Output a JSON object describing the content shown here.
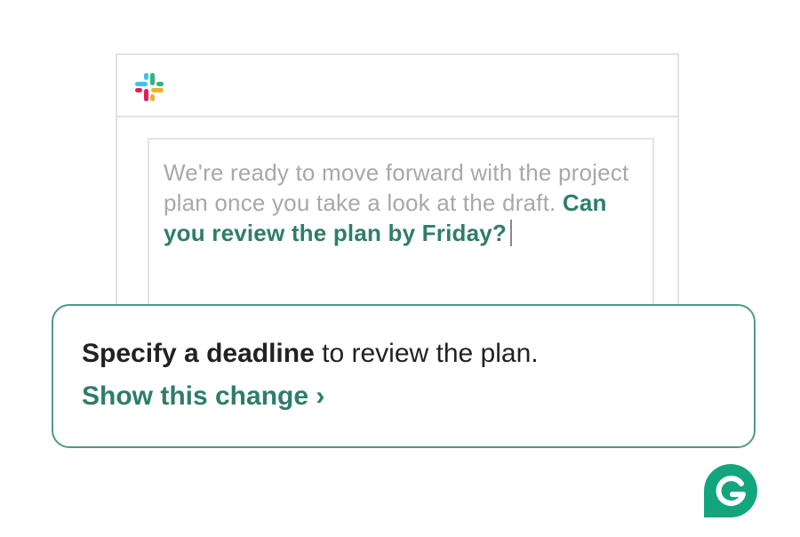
{
  "compose": {
    "text_plain": "We're ready to move forward with the project plan once you take a look at the draft.",
    "text_highlight": "Can you review the plan by Friday?"
  },
  "suggestion": {
    "bold": "Specify a deadline",
    "rest": "to review the plan.",
    "action_label": "Show this change ›"
  },
  "colors": {
    "accent": "#2e7d6b",
    "card_border": "#4f9a88",
    "placeholder_text": "#a8a8a8",
    "slack_blue": "#36C5F0",
    "slack_green": "#2EB67D",
    "slack_yellow": "#ECB22E",
    "slack_red": "#E01E5A",
    "grammarly_green": "#15a57e"
  },
  "icons": {
    "app_logo": "slack-logo-icon",
    "brand_logo": "grammarly-logo-icon"
  }
}
